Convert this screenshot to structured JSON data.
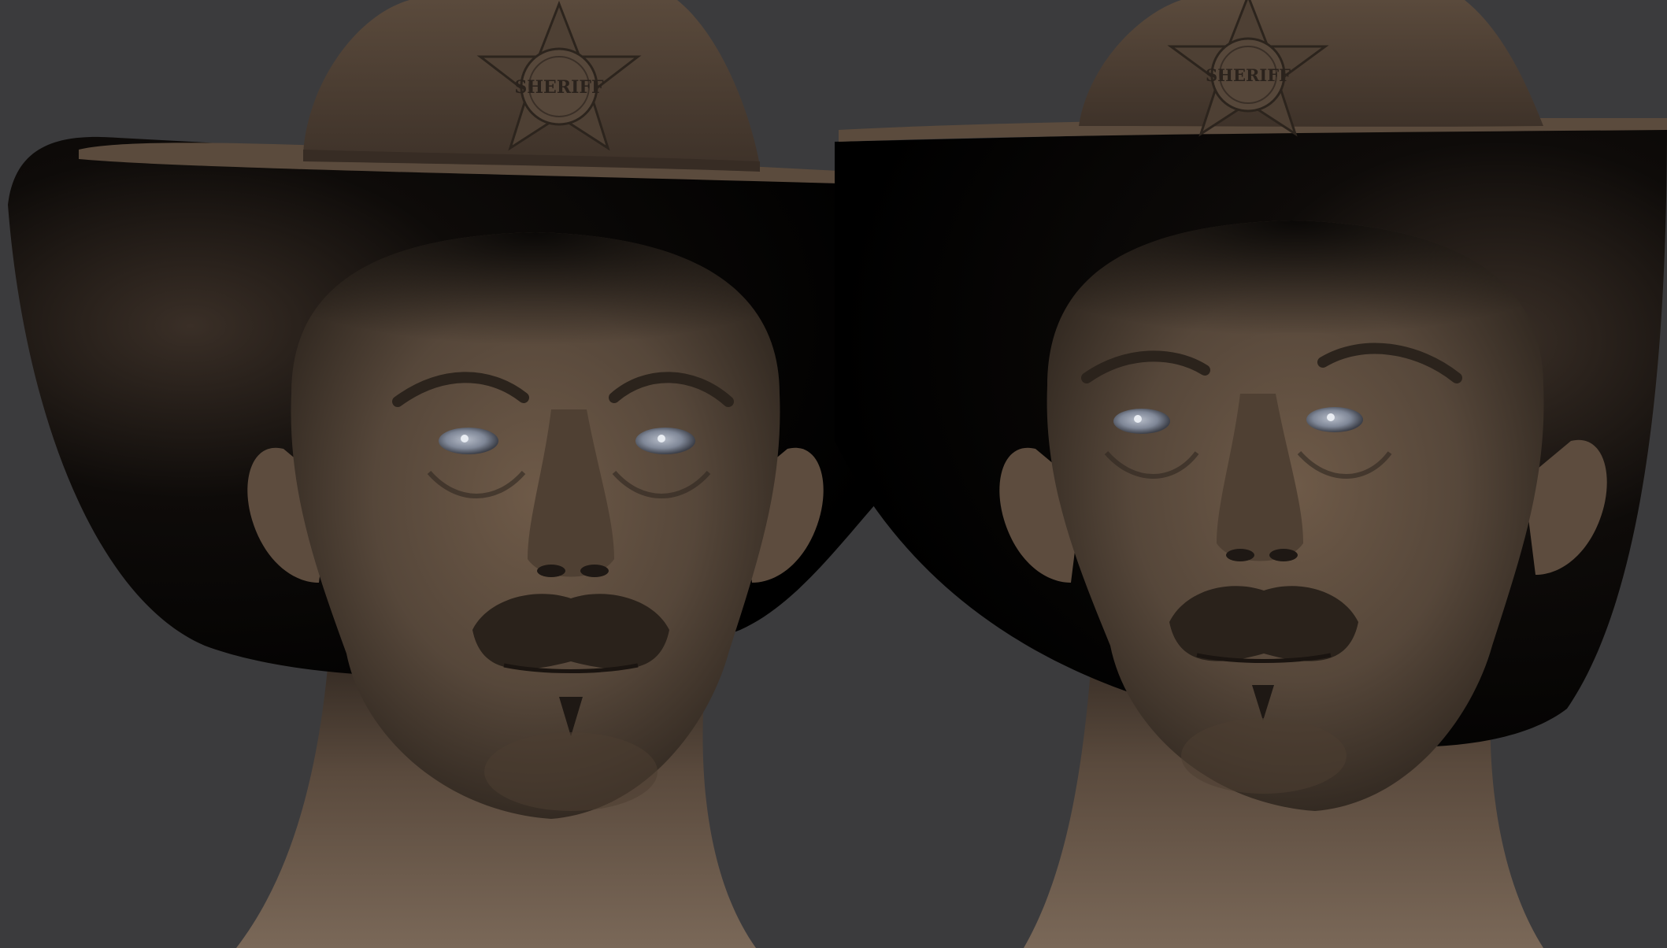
{
  "scene": {
    "background_color": "#3b3b3d",
    "material_color": "#5b4a3b",
    "hat_color": "#4c3f33",
    "eye_color": "#8e96a6"
  },
  "renders": [
    {
      "view": "front",
      "badge_text": "SHERIFF"
    },
    {
      "view": "three-quarter",
      "badge_text": "SHERIFF"
    }
  ]
}
